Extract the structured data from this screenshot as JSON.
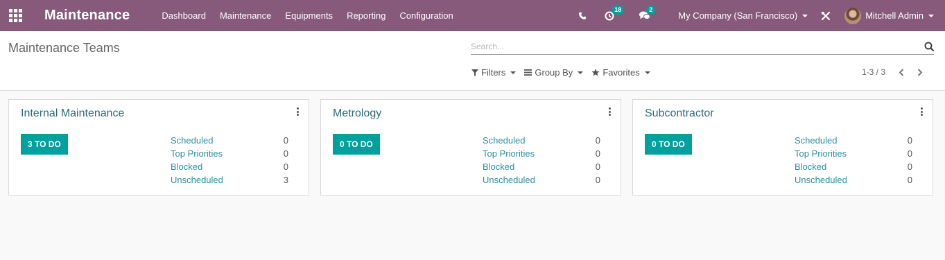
{
  "navbar": {
    "app_title": "Maintenance",
    "menu": [
      "Dashboard",
      "Maintenance",
      "Equipments",
      "Reporting",
      "Configuration"
    ],
    "activity_count": "18",
    "messages_count": "2",
    "company": "My Company (San Francisco)",
    "user": "Mitchell Admin",
    "colors": {
      "bar": "#875a7b",
      "badge": "#00a09d"
    },
    "icons": [
      "apps-grid-icon",
      "phone-icon",
      "clock-icon",
      "chat-icon",
      "tools-icon"
    ]
  },
  "control_panel": {
    "breadcrumb": "Maintenance Teams",
    "search_placeholder": "Search...",
    "filters": [
      "Filters",
      "Group By",
      "Favorites"
    ],
    "pager": "1-3 / 3"
  },
  "teams": [
    {
      "name": "Internal Maintenance",
      "todo": "3 TO DO",
      "stats": [
        {
          "label": "Scheduled",
          "value": "0"
        },
        {
          "label": "Top Priorities",
          "value": "0"
        },
        {
          "label": "Blocked",
          "value": "0"
        },
        {
          "label": "Unscheduled",
          "value": "3"
        }
      ]
    },
    {
      "name": "Metrology",
      "todo": "0 TO DO",
      "stats": [
        {
          "label": "Scheduled",
          "value": "0"
        },
        {
          "label": "Top Priorities",
          "value": "0"
        },
        {
          "label": "Blocked",
          "value": "0"
        },
        {
          "label": "Unscheduled",
          "value": "0"
        }
      ]
    },
    {
      "name": "Subcontractor",
      "todo": "0 TO DO",
      "stats": [
        {
          "label": "Scheduled",
          "value": "0"
        },
        {
          "label": "Top Priorities",
          "value": "0"
        },
        {
          "label": "Blocked",
          "value": "0"
        },
        {
          "label": "Unscheduled",
          "value": "0"
        }
      ]
    }
  ],
  "accent_color": "#00a09d"
}
